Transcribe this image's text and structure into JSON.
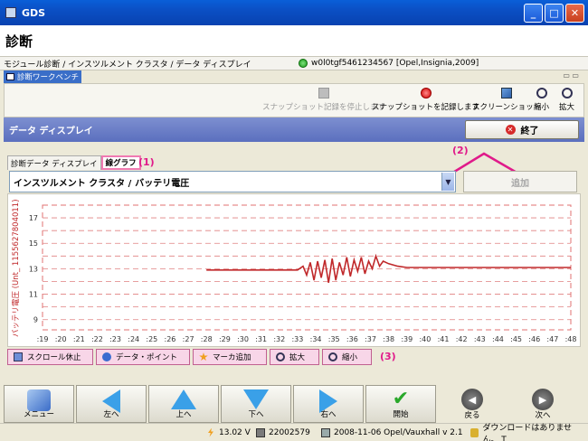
{
  "window": {
    "title": "GDS"
  },
  "header": {
    "title": "診断"
  },
  "breadcrumb": {
    "path": "モジュール診断 / インスツルメント クラスタ / データ ディスプレイ",
    "vehicle": "w0l0tgf5461234567 [Opel,Insignia,2009]"
  },
  "workbench": {
    "tab_label": "診断ワークベンチ",
    "window_ctrls": "▭ ▭"
  },
  "toolbar": {
    "stop_snapshot": "スナップショット記録を停止します",
    "record_snapshot": "スナップショットを記録します",
    "screenshot": "スクリーンショット",
    "zoom_out": "縮小",
    "zoom_in": "拡大"
  },
  "data_display": {
    "title": "データ ディスプレイ",
    "end_label": "終了"
  },
  "inner_tabs": [
    {
      "label": "診断データ ディスプレイ"
    },
    {
      "label": "線グラフ"
    }
  ],
  "annotations": {
    "n1": "(1)",
    "n2": "(2)",
    "n3": "(3)"
  },
  "signal": {
    "module": "インスツルメント クラスタ /",
    "name": "バッテリ電圧",
    "add_label": "追加"
  },
  "chart_data": {
    "type": "line",
    "ylabel": "バッテリ電圧 (Unt_ 1155627804011)",
    "ylim": [
      8.2,
      18
    ],
    "y_ticks": [
      "9",
      "11",
      "13",
      "15",
      "17"
    ],
    "x_ticks": [
      ":19",
      ":20",
      ":21",
      ":22",
      ":23",
      ":24",
      ":25",
      ":26",
      ":27",
      ":28",
      ":29",
      ":30",
      ":31",
      ":32",
      ":33",
      ":34",
      ":35",
      ":36",
      ":37",
      ":38",
      ":39",
      ":40",
      ":41",
      ":42",
      ":43",
      ":44",
      ":45",
      ":46",
      ":47",
      ":48"
    ],
    "series": [
      {
        "color": "#c0282a",
        "x": [
          28,
          33,
          33.3,
          33.5,
          33.7,
          33.9,
          34.1,
          34.3,
          34.5,
          34.7,
          34.9,
          35.1,
          35.3,
          35.5,
          35.7,
          35.9,
          36.1,
          36.3,
          36.5,
          36.7,
          36.9,
          37.1,
          37.3,
          37.5,
          37.7,
          38,
          38.5,
          39,
          40,
          42,
          48
        ],
        "y": [
          12.9,
          12.9,
          13.2,
          12.5,
          13.5,
          12.1,
          13.6,
          12.3,
          13.7,
          11.9,
          13.8,
          12.1,
          13.5,
          12.5,
          13.9,
          12.4,
          13.7,
          12.8,
          13.9,
          12.6,
          13.6,
          13.0,
          14.0,
          13.2,
          13.6,
          13.4,
          13.2,
          13.1,
          13.1,
          13.1,
          13.1
        ]
      }
    ]
  },
  "graph_controls": {
    "scroll_stop": "スクロール休止",
    "data_point": "データ・ポイント",
    "add_marker": "マーカ追加",
    "zoom_in": "拡大",
    "zoom_out": "縮小"
  },
  "nav": {
    "menu": "メニュー",
    "left": "左へ",
    "up": "上へ",
    "down": "下へ",
    "right": "右へ",
    "start": "開始",
    "back": "戻る",
    "next": "次へ"
  },
  "status": {
    "voltage": "13.02 V",
    "id": "22002579",
    "version": "2008-11-06 Opel/Vauxhall v 2.1",
    "download": "ダウンロードはありません。 T"
  }
}
